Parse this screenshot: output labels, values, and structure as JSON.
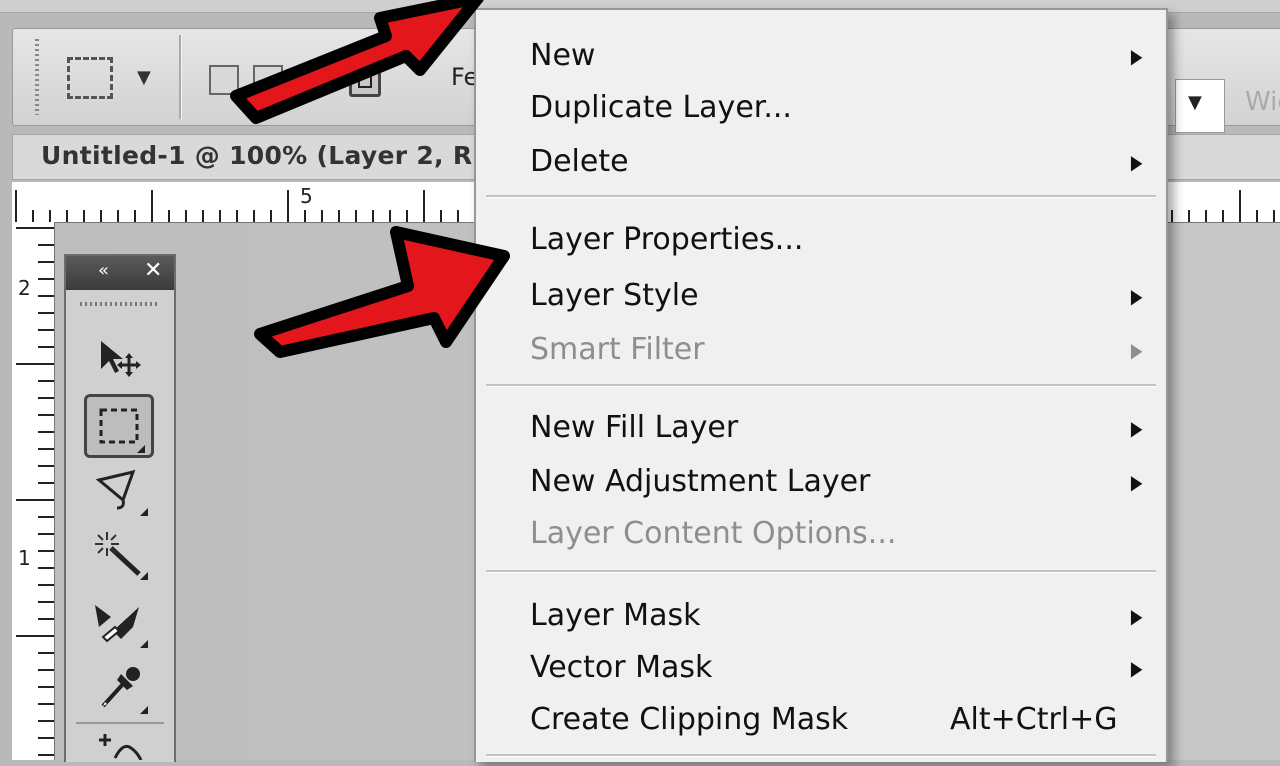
{
  "options_bar": {
    "feather_label_fragment": "Fe",
    "width_label_fragment": "Wic"
  },
  "document_tab": {
    "title": "Untitled-1 @ 100% (Layer 2, R"
  },
  "rulers": {
    "horizontal_mark": "5",
    "vertical_marks": [
      "2",
      "1"
    ]
  },
  "tools_panel": {
    "collapse_icon": "«",
    "close_icon": "✕",
    "tools": [
      "move-tool-icon",
      "rectangular-marquee-tool-icon",
      "lasso-tool-icon",
      "magic-wand-tool-icon",
      "crop-tool-icon",
      "eyedropper-tool-icon",
      "add-anchor-point-tool-icon"
    ],
    "active_tool": "rectangular-marquee-tool-icon"
  },
  "layer_menu": {
    "items": [
      {
        "label": "New",
        "submenu": true,
        "enabled": true
      },
      {
        "label": "Duplicate Layer...",
        "submenu": false,
        "enabled": true
      },
      {
        "label": "Delete",
        "submenu": true,
        "enabled": true
      },
      {
        "label": "Layer Properties...",
        "submenu": false,
        "enabled": true
      },
      {
        "label": "Layer Style",
        "submenu": true,
        "enabled": true
      },
      {
        "label": "Smart Filter",
        "submenu": true,
        "enabled": false
      },
      {
        "label": "New Fill Layer",
        "submenu": true,
        "enabled": true
      },
      {
        "label": "New Adjustment Layer",
        "submenu": true,
        "enabled": true
      },
      {
        "label": "Layer Content Options...",
        "submenu": false,
        "enabled": false
      },
      {
        "label": "Layer Mask",
        "submenu": true,
        "enabled": true
      },
      {
        "label": "Vector Mask",
        "submenu": true,
        "enabled": true
      },
      {
        "label": "Create Clipping Mask",
        "submenu": false,
        "enabled": true,
        "shortcut": "Alt+Ctrl+G"
      }
    ],
    "submenu_arrow": "▶"
  },
  "annotations": {
    "arrow_color": "#e3161b",
    "arrow_outline": "#000000"
  }
}
